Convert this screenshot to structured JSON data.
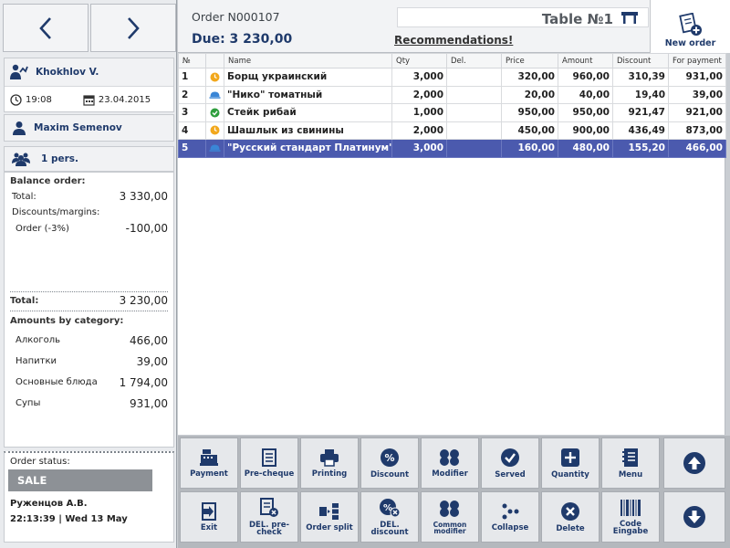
{
  "sidebar": {
    "waiter": "Khokhlov V.",
    "time": "19:08",
    "date": "23.04.2015",
    "customer": "Maxim Semenov",
    "guests": "1 pers.",
    "balance": {
      "header": "Balance order:",
      "total_label": "Total:",
      "total_value": "3 330,00",
      "discounts_label": "Discounts/margins:",
      "discount_item_label": "Order (-3%)",
      "discount_item_value": "-100,00",
      "final_label": "Total:",
      "final_value": "3 230,00",
      "categories_header": "Amounts by category:",
      "categories": [
        {
          "name": "Алкоголь",
          "value": "466,00"
        },
        {
          "name": "Напитки",
          "value": "39,00"
        },
        {
          "name": "Основные блюда",
          "value": "1 794,00"
        },
        {
          "name": "Супы",
          "value": "931,00"
        }
      ]
    },
    "status": {
      "label": "Order status:",
      "value": "SALE",
      "cashier": "Руженцов А.В.",
      "datetime": "22:13:39 | Wed 13 May"
    }
  },
  "header": {
    "order_number": "Order N000107",
    "due": "Due: 3 230,00",
    "table": "Table №1",
    "recommendations": "Recommendations!",
    "new_order": "New order"
  },
  "table": {
    "columns": [
      "№",
      "",
      "Name",
      "Qty",
      "Del.",
      "Price",
      "Amount",
      "Discount",
      "For payment"
    ],
    "rows": [
      {
        "no": "1",
        "status": "clock-orange",
        "name": "Борщ украинский",
        "qty": "3,000",
        "del": "",
        "price": "320,00",
        "amount": "960,00",
        "discount": "310,39",
        "pay": "931,00"
      },
      {
        "no": "2",
        "status": "cloche-blue",
        "name": "\"Нико\" томатный",
        "qty": "2,000",
        "del": "",
        "price": "20,00",
        "amount": "40,00",
        "discount": "19,40",
        "pay": "39,00"
      },
      {
        "no": "3",
        "status": "check-green",
        "name": "Стейк рибай",
        "qty": "1,000",
        "del": "",
        "price": "950,00",
        "amount": "950,00",
        "discount": "921,47",
        "pay": "921,00"
      },
      {
        "no": "4",
        "status": "clock-orange",
        "name": "Шашлык из свинины",
        "qty": "2,000",
        "del": "",
        "price": "450,00",
        "amount": "900,00",
        "discount": "436,49",
        "pay": "873,00"
      },
      {
        "no": "5",
        "status": "cloche-blue",
        "name": "\"Русский стандарт Платинум\"",
        "qty": "3,000",
        "del": "",
        "price": "160,00",
        "amount": "480,00",
        "discount": "155,20",
        "pay": "466,00"
      }
    ]
  },
  "toolbar": {
    "row1": [
      "Payment",
      "Pre-cheque",
      "Printing",
      "Discount",
      "Modifier",
      "Served",
      "Quantity",
      "Menu"
    ],
    "row2": [
      "Exit",
      "DEL. pre-check",
      "Order split",
      "DEL. discount",
      "Common modifier",
      "Collapse",
      "Delete",
      "Code Eingabe"
    ]
  },
  "colors": {
    "accent": "#1f3a6b",
    "selected_row": "#4b5aae",
    "sale_badge": "#8d9196"
  }
}
